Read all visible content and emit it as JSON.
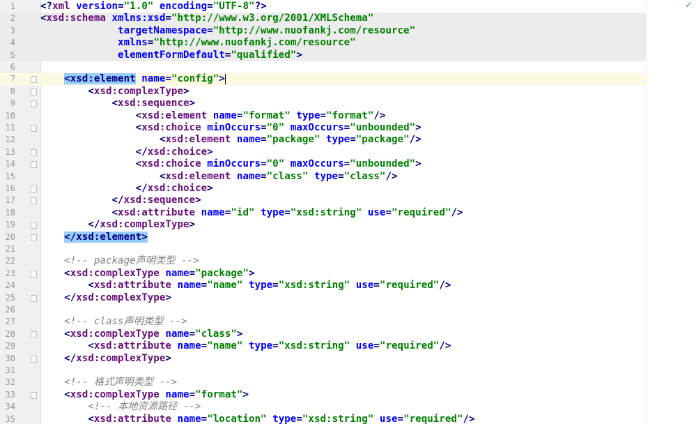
{
  "editor": {
    "status_icon": "✓",
    "status_icon_name": "check-icon",
    "colors": {
      "tag": "#000080",
      "ns": "#660e7a",
      "attr": "#0000ff",
      "value": "#008000",
      "comment": "#808080",
      "match": "#99ccff",
      "gutter": "#f0f0f0"
    }
  },
  "lines": [
    {
      "n": "1",
      "tokens": [
        [
          "t",
          "<?"
        ],
        [
          "n",
          "xml "
        ],
        [
          "a",
          "version"
        ],
        [
          "t",
          "="
        ],
        [
          "v",
          "\"1.0\""
        ],
        [
          "t",
          " "
        ],
        [
          "a",
          "encoding"
        ],
        [
          "t",
          "="
        ],
        [
          "v",
          "\"UTF-8\""
        ],
        [
          "t",
          "?>"
        ]
      ]
    },
    {
      "n": "2",
      "bg": true,
      "tokens": [
        [
          "t",
          "<"
        ],
        [
          "n",
          "xsd:schema "
        ],
        [
          "a",
          "xmlns:xsd"
        ],
        [
          "t",
          "="
        ],
        [
          "v",
          "\"http://www.w3.org/2001/XMLSchema\""
        ]
      ]
    },
    {
      "n": "3",
      "bg": true,
      "tokens": [
        [
          "t",
          "             "
        ],
        [
          "a",
          "targetNamespace"
        ],
        [
          "t",
          "="
        ],
        [
          "v",
          "\"http://www.nuofankj.com/resource\""
        ]
      ]
    },
    {
      "n": "4",
      "bg": true,
      "tokens": [
        [
          "t",
          "             "
        ],
        [
          "a",
          "xmlns"
        ],
        [
          "t",
          "="
        ],
        [
          "v",
          "\"http://www.nuofankj.com/resource\""
        ]
      ]
    },
    {
      "n": "5",
      "bg": true,
      "tokens": [
        [
          "t",
          "             "
        ],
        [
          "a",
          "elementFormDefault"
        ],
        [
          "t",
          "="
        ],
        [
          "v",
          "\"qualified\""
        ],
        [
          "t",
          ">"
        ]
      ]
    },
    {
      "n": "6",
      "tokens": []
    },
    {
      "n": "7",
      "caret": true,
      "fold": true,
      "tokens": [
        [
          "t",
          "    "
        ],
        [
          "m",
          "<xsd:element"
        ],
        [
          "t",
          " "
        ],
        [
          "a",
          "name"
        ],
        [
          "t",
          "="
        ],
        [
          "v",
          "\"config\""
        ],
        [
          "t",
          ">"
        ],
        [
          "c",
          ""
        ]
      ]
    },
    {
      "n": "8",
      "fold": true,
      "tokens": [
        [
          "t",
          "        <"
        ],
        [
          "n",
          "xsd:complexType"
        ],
        [
          "t",
          ">"
        ]
      ]
    },
    {
      "n": "9",
      "fold": true,
      "tokens": [
        [
          "t",
          "            <"
        ],
        [
          "n",
          "xsd:sequence"
        ],
        [
          "t",
          ">"
        ]
      ]
    },
    {
      "n": "10",
      "tokens": [
        [
          "t",
          "                <"
        ],
        [
          "n",
          "xsd:element "
        ],
        [
          "a",
          "name"
        ],
        [
          "t",
          "="
        ],
        [
          "v",
          "\"format\""
        ],
        [
          "t",
          " "
        ],
        [
          "a",
          "type"
        ],
        [
          "t",
          "="
        ],
        [
          "v",
          "\"format\""
        ],
        [
          "t",
          "/>"
        ]
      ]
    },
    {
      "n": "11",
      "fold": true,
      "tokens": [
        [
          "t",
          "                <"
        ],
        [
          "n",
          "xsd:choice "
        ],
        [
          "a",
          "minOccurs"
        ],
        [
          "t",
          "="
        ],
        [
          "v",
          "\"0\""
        ],
        [
          "t",
          " "
        ],
        [
          "a",
          "maxOccurs"
        ],
        [
          "t",
          "="
        ],
        [
          "v",
          "\"unbounded\""
        ],
        [
          "t",
          ">"
        ]
      ]
    },
    {
      "n": "12",
      "tokens": [
        [
          "t",
          "                    <"
        ],
        [
          "n",
          "xsd:element "
        ],
        [
          "a",
          "name"
        ],
        [
          "t",
          "="
        ],
        [
          "v",
          "\"package\""
        ],
        [
          "t",
          " "
        ],
        [
          "a",
          "type"
        ],
        [
          "t",
          "="
        ],
        [
          "v",
          "\"package\""
        ],
        [
          "t",
          "/>"
        ]
      ]
    },
    {
      "n": "13",
      "fold": true,
      "tokens": [
        [
          "t",
          "                </"
        ],
        [
          "n",
          "xsd:choice"
        ],
        [
          "t",
          ">"
        ]
      ]
    },
    {
      "n": "14",
      "fold": true,
      "tokens": [
        [
          "t",
          "                <"
        ],
        [
          "n",
          "xsd:choice "
        ],
        [
          "a",
          "minOccurs"
        ],
        [
          "t",
          "="
        ],
        [
          "v",
          "\"0\""
        ],
        [
          "t",
          " "
        ],
        [
          "a",
          "maxOccurs"
        ],
        [
          "t",
          "="
        ],
        [
          "v",
          "\"unbounded\""
        ],
        [
          "t",
          ">"
        ]
      ]
    },
    {
      "n": "15",
      "tokens": [
        [
          "t",
          "                    <"
        ],
        [
          "n",
          "xsd:element "
        ],
        [
          "a",
          "name"
        ],
        [
          "t",
          "="
        ],
        [
          "v",
          "\"class\""
        ],
        [
          "t",
          " "
        ],
        [
          "a",
          "type"
        ],
        [
          "t",
          "="
        ],
        [
          "v",
          "\"class\""
        ],
        [
          "t",
          "/>"
        ]
      ]
    },
    {
      "n": "16",
      "fold": true,
      "tokens": [
        [
          "t",
          "                </"
        ],
        [
          "n",
          "xsd:choice"
        ],
        [
          "t",
          ">"
        ]
      ]
    },
    {
      "n": "17",
      "fold": true,
      "tokens": [
        [
          "t",
          "            </"
        ],
        [
          "n",
          "xsd:sequence"
        ],
        [
          "t",
          ">"
        ]
      ]
    },
    {
      "n": "18",
      "tokens": [
        [
          "t",
          "            <"
        ],
        [
          "n",
          "xsd:attribute "
        ],
        [
          "a",
          "name"
        ],
        [
          "t",
          "="
        ],
        [
          "v",
          "\"id\""
        ],
        [
          "t",
          " "
        ],
        [
          "a",
          "type"
        ],
        [
          "t",
          "="
        ],
        [
          "v",
          "\"xsd:string\""
        ],
        [
          "t",
          " "
        ],
        [
          "a",
          "use"
        ],
        [
          "t",
          "="
        ],
        [
          "v",
          "\"required\""
        ],
        [
          "t",
          "/>"
        ]
      ]
    },
    {
      "n": "19",
      "fold": true,
      "tokens": [
        [
          "t",
          "        </"
        ],
        [
          "n",
          "xsd:complexType"
        ],
        [
          "t",
          ">"
        ]
      ]
    },
    {
      "n": "20",
      "fold": true,
      "tokens": [
        [
          "t",
          "    "
        ],
        [
          "m",
          "</xsd:element>"
        ]
      ]
    },
    {
      "n": "21",
      "tokens": []
    },
    {
      "n": "22",
      "tokens": [
        [
          "t",
          "    "
        ],
        [
          "k",
          "<!-- package"
        ],
        [
          "j",
          "声明类型"
        ],
        [
          "k",
          " -->"
        ]
      ]
    },
    {
      "n": "23",
      "fold": true,
      "tokens": [
        [
          "t",
          "    <"
        ],
        [
          "n",
          "xsd:complexType "
        ],
        [
          "a",
          "name"
        ],
        [
          "t",
          "="
        ],
        [
          "v",
          "\"package\""
        ],
        [
          "t",
          ">"
        ]
      ]
    },
    {
      "n": "24",
      "tokens": [
        [
          "t",
          "        <"
        ],
        [
          "n",
          "xsd:attribute "
        ],
        [
          "a",
          "name"
        ],
        [
          "t",
          "="
        ],
        [
          "v",
          "\"name\""
        ],
        [
          "t",
          " "
        ],
        [
          "a",
          "type"
        ],
        [
          "t",
          "="
        ],
        [
          "v",
          "\"xsd:string\""
        ],
        [
          "t",
          " "
        ],
        [
          "a",
          "use"
        ],
        [
          "t",
          "="
        ],
        [
          "v",
          "\"required\""
        ],
        [
          "t",
          "/>"
        ]
      ]
    },
    {
      "n": "25",
      "fold": true,
      "tokens": [
        [
          "t",
          "    </"
        ],
        [
          "n",
          "xsd:complexType"
        ],
        [
          "t",
          ">"
        ]
      ]
    },
    {
      "n": "26",
      "tokens": []
    },
    {
      "n": "27",
      "tokens": [
        [
          "t",
          "    "
        ],
        [
          "k",
          "<!-- class"
        ],
        [
          "j",
          "声明类型"
        ],
        [
          "k",
          " -->"
        ]
      ]
    },
    {
      "n": "28",
      "fold": true,
      "tokens": [
        [
          "t",
          "    <"
        ],
        [
          "n",
          "xsd:complexType "
        ],
        [
          "a",
          "name"
        ],
        [
          "t",
          "="
        ],
        [
          "v",
          "\"class\""
        ],
        [
          "t",
          ">"
        ]
      ]
    },
    {
      "n": "29",
      "tokens": [
        [
          "t",
          "        <"
        ],
        [
          "n",
          "xsd:attribute "
        ],
        [
          "a",
          "name"
        ],
        [
          "t",
          "="
        ],
        [
          "v",
          "\"name\""
        ],
        [
          "t",
          " "
        ],
        [
          "a",
          "type"
        ],
        [
          "t",
          "="
        ],
        [
          "v",
          "\"xsd:string\""
        ],
        [
          "t",
          " "
        ],
        [
          "a",
          "use"
        ],
        [
          "t",
          "="
        ],
        [
          "v",
          "\"required\""
        ],
        [
          "t",
          "/>"
        ]
      ]
    },
    {
      "n": "30",
      "fold": true,
      "tokens": [
        [
          "t",
          "    </"
        ],
        [
          "n",
          "xsd:complexType"
        ],
        [
          "t",
          ">"
        ]
      ]
    },
    {
      "n": "31",
      "tokens": []
    },
    {
      "n": "32",
      "tokens": [
        [
          "t",
          "    "
        ],
        [
          "k",
          "<!-- "
        ],
        [
          "j",
          "格式声明类型"
        ],
        [
          "k",
          " -->"
        ]
      ]
    },
    {
      "n": "33",
      "fold": true,
      "tokens": [
        [
          "t",
          "    <"
        ],
        [
          "n",
          "xsd:complexType "
        ],
        [
          "a",
          "name"
        ],
        [
          "t",
          "="
        ],
        [
          "v",
          "\"format\""
        ],
        [
          "t",
          ">"
        ]
      ]
    },
    {
      "n": "34",
      "tokens": [
        [
          "t",
          "        "
        ],
        [
          "k",
          "<!-- "
        ],
        [
          "j",
          "本地资源路径"
        ],
        [
          "k",
          " -->"
        ]
      ]
    },
    {
      "n": "35",
      "tokens": [
        [
          "t",
          "        <"
        ],
        [
          "n",
          "xsd:attribute "
        ],
        [
          "a",
          "name"
        ],
        [
          "t",
          "="
        ],
        [
          "v",
          "\"location\""
        ],
        [
          "t",
          " "
        ],
        [
          "a",
          "type"
        ],
        [
          "t",
          "="
        ],
        [
          "v",
          "\"xsd:string\""
        ],
        [
          "t",
          " "
        ],
        [
          "a",
          "use"
        ],
        [
          "t",
          "="
        ],
        [
          "v",
          "\"required\""
        ],
        [
          "t",
          "/>"
        ]
      ]
    }
  ]
}
